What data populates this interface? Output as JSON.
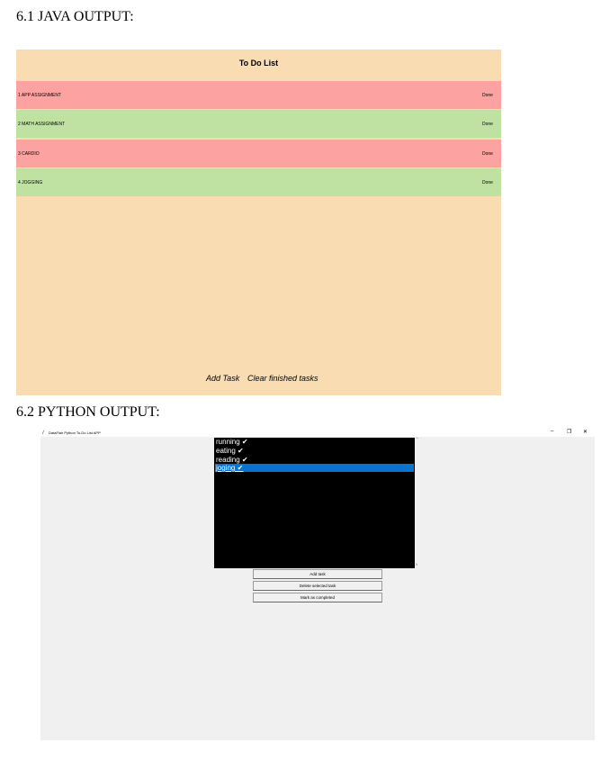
{
  "headings": {
    "java": "6.1 JAVA OUTPUT:",
    "python": "6.2 PYTHON OUTPUT:"
  },
  "java_app": {
    "title": "To Do List",
    "tasks": [
      {
        "label": "1 APP ASSIGNMENT",
        "action": "Done",
        "color": "#fca2a0"
      },
      {
        "label": "2 MATH ASSIGNMENT",
        "action": "Done",
        "color": "#bfe2a3"
      },
      {
        "label": "3 CARDIO",
        "action": "Done",
        "color": "#fca2a0"
      },
      {
        "label": "4 JOGGING",
        "action": "Done",
        "color": "#bfe2a3"
      }
    ],
    "add_task_label": "Add Task",
    "clear_finished_label": "Clear finished tasks",
    "background": "#fadcb2"
  },
  "python_app": {
    "window_title": "DataFlair Python To-Do List APP",
    "window_icon": "feather-icon",
    "controls": {
      "minimize": "–",
      "maximize": "❐",
      "close": "✕"
    },
    "listbox_items": [
      "running ✔",
      "eating ✔",
      "reading   ✔",
      "joging ✔"
    ],
    "selected_index": 3,
    "selection_color": "#0a72cf",
    "buttons": {
      "add": "Add task",
      "delete": "Delete selected task",
      "mark": "Mark as completed"
    }
  }
}
